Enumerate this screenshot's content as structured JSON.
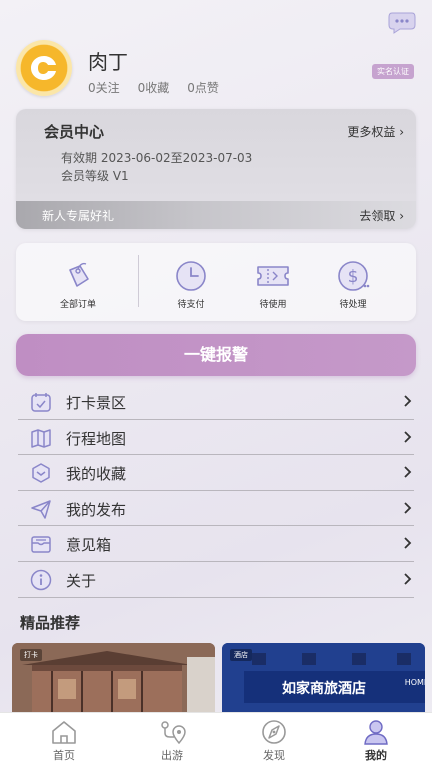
{
  "profile": {
    "username": "肉丁",
    "follows": "0关注",
    "favorites": "0收藏",
    "likes": "0点赞",
    "verify_badge": "实名认证"
  },
  "member": {
    "title": "会员中心",
    "more": "更多权益",
    "valid_label": "有效期",
    "valid_range": "2023-06-02至2023-07-03",
    "level_label": "会员等级",
    "level": "V1",
    "gift": "新人专属好礼",
    "claim": "去领取"
  },
  "orders": {
    "items": [
      {
        "label": "全部订单",
        "icon": "tag-icon"
      },
      {
        "label": "待支付",
        "icon": "clock-icon"
      },
      {
        "label": "待使用",
        "icon": "ticket-icon"
      },
      {
        "label": "待处理",
        "icon": "dollar-icon"
      }
    ]
  },
  "sos": {
    "label": "一键报警"
  },
  "menu": {
    "items": [
      {
        "label": "打卡景区",
        "icon": "calendar-check-icon"
      },
      {
        "label": "行程地图",
        "icon": "map-icon"
      },
      {
        "label": "我的收藏",
        "icon": "cube-icon"
      },
      {
        "label": "我的发布",
        "icon": "send-icon"
      },
      {
        "label": "意见箱",
        "icon": "mailbox-icon"
      },
      {
        "label": "关于",
        "icon": "info-icon"
      }
    ]
  },
  "recommend": {
    "title": "精品推荐",
    "cards": [
      {
        "tag": "打卡",
        "image": "ancient-building-photo"
      },
      {
        "tag": "酒店",
        "sign": "如家商旅酒店",
        "sign_en": "HOME",
        "image": "hotel-photo"
      }
    ]
  },
  "tabbar": {
    "items": [
      {
        "label": "首页",
        "icon": "home-icon"
      },
      {
        "label": "出游",
        "icon": "route-icon"
      },
      {
        "label": "发现",
        "icon": "compass-icon"
      },
      {
        "label": "我的",
        "icon": "user-icon",
        "active": true
      }
    ]
  },
  "colors": {
    "accent": "#c599c9",
    "icon_purple": "#8a86c9",
    "badge": "#c6a3cf"
  }
}
